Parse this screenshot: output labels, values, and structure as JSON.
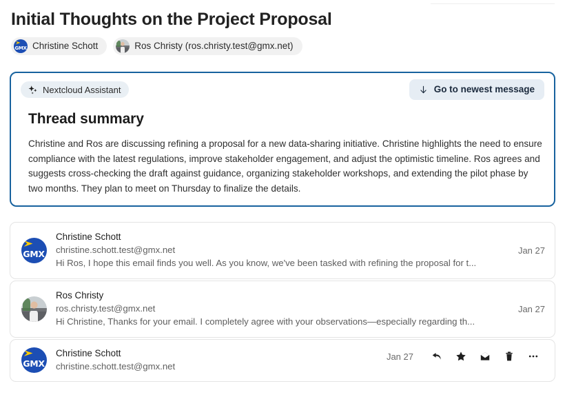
{
  "thread": {
    "title": "Initial Thoughts on the Project Proposal",
    "participants": [
      {
        "name": "Christine Schott",
        "avatar": "gmx-logo-avatar"
      },
      {
        "name": "Ros Christy (ros.christy.test@gmx.net)",
        "avatar": "photo-avatar"
      }
    ]
  },
  "assistant": {
    "badge_label": "Nextcloud Assistant",
    "badge_icon": "sparkles-icon",
    "goto_newest_label": "Go to newest message",
    "goto_newest_icon": "arrow-down-icon",
    "summary_heading": "Thread summary",
    "summary_text": "Christine and Ros are discussing refining a proposal for a new data-sharing initiative. Christine highlights the need to ensure compliance with the latest regulations, improve stakeholder engagement, and adjust the optimistic timeline. Ros agrees and suggests cross-checking the draft against guidance, organizing stakeholder workshops, and extending the pilot phase by two months. They plan to meet on Thursday to finalize the details.",
    "border_color": "#17629e",
    "badge_bg": "#e9eff4",
    "button_bg": "#e6edf4"
  },
  "messages": [
    {
      "sender": "Christine Schott",
      "address": "christine.schott.test@gmx.net",
      "preview": "Hi Ros, I hope this email finds you well. As you know, we've been tasked with refining the proposal for t...",
      "date": "Jan 27",
      "avatar": "gmx-logo-avatar"
    },
    {
      "sender": "Ros Christy",
      "address": "ros.christy.test@gmx.net",
      "preview": "Hi Christine, Thanks for your email. I completely agree with your observations—especially regarding th...",
      "date": "Jan 27",
      "avatar": "photo-avatar"
    },
    {
      "sender": "Christine Schott",
      "address": "christine.schott.test@gmx.net",
      "preview": "",
      "date": "Jan 27",
      "avatar": "gmx-logo-avatar",
      "actions": [
        {
          "name": "reply-icon",
          "label": "Reply"
        },
        {
          "name": "star-icon",
          "label": "Favorite"
        },
        {
          "name": "envelope-open-icon",
          "label": "Mark unread"
        },
        {
          "name": "trash-icon",
          "label": "Delete"
        },
        {
          "name": "more-icon",
          "label": "More actions"
        }
      ]
    }
  ],
  "brand": {
    "gmx_text": "GMX",
    "gmx_blue": "#1c4eb4",
    "gmx_yellow": "#ffcc00"
  }
}
